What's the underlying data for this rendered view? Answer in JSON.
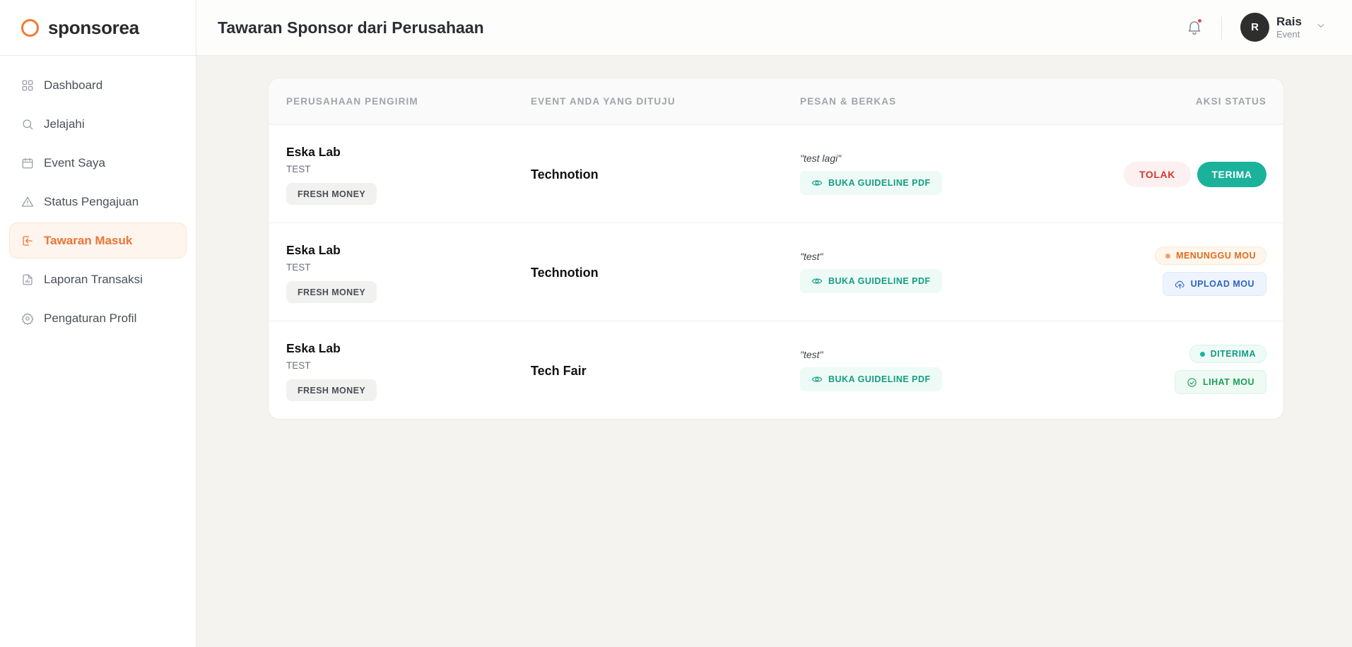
{
  "brand": {
    "name": "sponsorea"
  },
  "sidebar": {
    "items": [
      {
        "label": "Dashboard",
        "icon": "grid-icon"
      },
      {
        "label": "Jelajahi",
        "icon": "search-icon"
      },
      {
        "label": "Event Saya",
        "icon": "calendar-icon"
      },
      {
        "label": "Status Pengajuan",
        "icon": "warning-triangle-icon"
      },
      {
        "label": "Tawaran Masuk",
        "icon": "inbox-arrow-icon",
        "active": true
      },
      {
        "label": "Laporan Transaksi",
        "icon": "report-file-icon"
      },
      {
        "label": "Pengaturan Profil",
        "icon": "gear-icon"
      }
    ]
  },
  "header": {
    "title": "Tawaran Sponsor dari Perusahaan",
    "user": {
      "initial": "R",
      "name": "Rais",
      "role": "Event"
    }
  },
  "table": {
    "columns": [
      "PERUSAHAAN PENGIRIM",
      "EVENT ANDA YANG DITUJU",
      "PESAN & BERKAS",
      "AKSI STATUS"
    ],
    "pdf_label": "BUKA GUIDELINE PDF",
    "rows": [
      {
        "company": "Eska Lab",
        "company_sub": "TEST",
        "tag": "FRESH MONEY",
        "event": "Technotion",
        "message": "\"test lagi\"",
        "actions": {
          "reject": "TOLAK",
          "accept": "TERIMA"
        }
      },
      {
        "company": "Eska Lab",
        "company_sub": "TEST",
        "tag": "FRESH MONEY",
        "event": "Technotion",
        "message": "\"test\"",
        "status": "MENUNGGU MOU",
        "action": "UPLOAD MOU"
      },
      {
        "company": "Eska Lab",
        "company_sub": "TEST",
        "tag": "FRESH MONEY",
        "event": "Tech Fair",
        "message": "\"test\"",
        "status": "DITERIMA",
        "action": "LIHAT MOU"
      }
    ]
  },
  "colors": {
    "accent": "#ee7434",
    "teal": "#1bb29b",
    "danger": "#d5372f",
    "info": "#2b64c8"
  }
}
